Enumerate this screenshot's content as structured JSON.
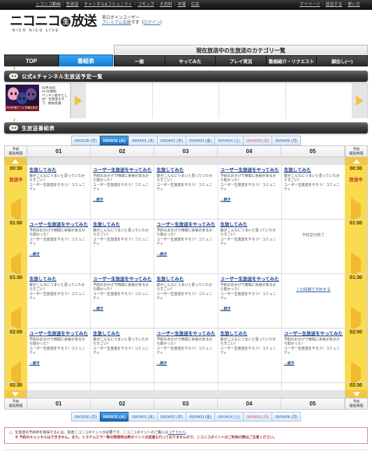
{
  "globalnav": {
    "left_links": [
      "ニコニコ動画",
      "生放送",
      "チャンネル&コミュニティ",
      "コモンズ",
      "大百科",
      "市場",
      "広告"
    ],
    "right_links": [
      "マイページ",
      "放送する",
      "使い方"
    ]
  },
  "logo": {
    "main_left": "ニコニコ",
    "ball": "生",
    "main_right": "放送",
    "sub": "NICO NICO  LIVE",
    "login_line1": "非ログインユーザー",
    "login_premium": "プレミアム会員",
    "login_suffix": "です（",
    "login_link": "ログイン",
    "login_close": "）"
  },
  "tabs": {
    "main": [
      {
        "label": "TOP",
        "active": false
      },
      {
        "label": "番組表",
        "active": true
      }
    ],
    "category_title": "現在放送中の生放送のカテゴリ一覧",
    "categories": [
      "一般",
      "やってみた",
      "プレイ実況",
      "動画紹介・リクエスト",
      "顔出し(一)"
    ]
  },
  "official_section": {
    "heading": "公式&チャンネル生放送予定一覧",
    "prev_label": "前へ",
    "next_label": "次へ",
    "items": [
      {
        "date": "03月29日",
        "time": "21:00開始",
        "title": "ペンギン娘すたじ",
        "subtitle": "お！生放送ます",
        "extra": "プ、極秘会議",
        "caption": "2009年春アニメ 特番生放送"
      }
    ]
  },
  "schedule_section": {
    "heading": "生放送番組表",
    "dates": [
      {
        "label": "09/03/30 (月)",
        "active": false,
        "kind": "weekday"
      },
      {
        "label": "09/03/31 (火)",
        "active": true,
        "kind": "weekday"
      },
      {
        "label": "09/04/01 (水)",
        "active": false,
        "kind": "weekday"
      },
      {
        "label": "09/04/02 (木)",
        "active": false,
        "kind": "weekday"
      },
      {
        "label": "09/04/03 (金)",
        "active": false,
        "kind": "weekday"
      },
      {
        "label": "09/04/04 (土)",
        "active": false,
        "kind": "sat"
      },
      {
        "label": "09/04/05 (日)",
        "active": false,
        "kind": "sun"
      },
      {
        "label": "09/04/06 (月)",
        "active": false,
        "kind": "weekday"
      }
    ],
    "side_header_line1": "予約",
    "side_header_line2": "開始時間",
    "columns": [
      "01",
      "02",
      "03",
      "04",
      "05"
    ],
    "onair_label": "放送中",
    "scroll_up_label": "上へスクロール",
    "scroll_down_label": "下へスクロール",
    "slots": [
      {
        "time": "00:30",
        "onair": true,
        "cells": [
          {
            "title": "生放してみた",
            "desc": "歌がこんなにうまいと思っていたからすごい！",
            "meta": "ユーザー生放送をやろう！コミュニティ",
            "more": ""
          },
          {
            "title": "ユーザー生放送をやってみた",
            "desc": "予約のおかげで時間に余裕があるから助かった！",
            "meta": "ユーザー生放送をやろう！コミュニティ",
            "more": "…続き"
          },
          {
            "title": "生放してみた",
            "desc": "歌がこんなにうまいと思っていたからすごい！",
            "meta": "ユーザー生放送をやろう！コミュニティ",
            "more": ""
          },
          {
            "title": "ユーザー生放送をやってみた",
            "desc": "予約のおかげで時間に余裕があるから助かった！",
            "meta": "ユーザー生放送をやろう！コミュニティ",
            "more": "…続き"
          },
          {
            "title": "生放してみた",
            "desc": "歌がこんなにうまいと思っていたからすごい！",
            "meta": "ユーザー生放送をやろう！コミュニティ",
            "more": ""
          }
        ]
      },
      {
        "time": "01:00",
        "onair": false,
        "cells": [
          {
            "title": "ユーザー生放送をやってみた",
            "desc": "予約のおかげで時間に余裕があるから助かった！",
            "meta": "ユーザー生放送をやろう！コミュニティ",
            "more": "…続き"
          },
          {
            "title": "生放してみた",
            "desc": "歌がこんなにうまいと思っていたからすごい！",
            "meta": "ユーザー生放送をやろう！コミュニティ",
            "more": ""
          },
          {
            "title": "ユーザー生放送をやってみた",
            "desc": "予約のおかげで時間に余裕があるから助かった！",
            "meta": "ユーザー生放送をやろう！コミュニティ",
            "more": "…続き"
          },
          {
            "title": "生放してみた",
            "desc": "歌がこんなにうまいと思っていたからすごい！",
            "meta": "ユーザー生放送をやろう！コミュニティ",
            "more": ""
          },
          {
            "empty_label": "予約受付終了"
          }
        ]
      },
      {
        "time": "01:30",
        "onair": false,
        "cells": [
          {
            "title": "生放してみた",
            "desc": "歌がこんなにうまいと思っていたからすごい！",
            "meta": "ユーザー生放送をやろう！コミュニティ",
            "more": ""
          },
          {
            "title": "ユーザー生放送をやってみた",
            "desc": "予約のおかげで時間に余裕があるから助かった！",
            "meta": "ユーザー生放送をやろう！コミュニティ",
            "more": "…続き"
          },
          {
            "title": "生放してみた",
            "desc": "歌がこんなにうまいと思っていたからすごい！",
            "meta": "ユーザー生放送をやろう！コミュニティ",
            "more": ""
          },
          {
            "title": "ユーザー生放送をやってみた",
            "desc": "予約のおかげで時間に余裕があるから助かった！",
            "meta": "ユーザー生放送をやろう！コミュニティ",
            "more": "…続き"
          },
          {
            "reserve_label": "この時間で予約する"
          }
        ]
      },
      {
        "time": "02:00",
        "onair": false,
        "cells": [
          {
            "title": "ユーザー生放送をやってみた",
            "desc": "予約のおかげで時間に余裕があるから助かった！",
            "meta": "ユーザー生放送をやろう！コミュニティ",
            "more": "…続き"
          },
          {
            "title": "生放してみた",
            "desc": "歌がこんなにうまいと思っていたからすごい！",
            "meta": "ユーザー生放送をやろう！コミュニティ",
            "more": ""
          },
          {
            "title": "ユーザー生放送をやってみた",
            "desc": "予約のおかげで時間に余裕があるから助かった！",
            "meta": "ユーザー生放送をやろう！コミュニティ",
            "more": "…続き"
          },
          {
            "title": "生放してみた",
            "desc": "歌がこんなにうまいと思っていたからすごい！",
            "meta": "ユーザー生放送をやろう！コミュニティ",
            "more": ""
          },
          {
            "title": "ユーザー生放送をやってみた",
            "desc": "予約のおかげで時間に余裕があるから助かった！",
            "meta": "ユーザー生放送をやろう！コミュニティ",
            "more": "…続き"
          }
        ]
      },
      {
        "time": "02:30",
        "onair": false,
        "cells": []
      }
    ]
  },
  "notice": {
    "line1_a": "生放送の予約枠を取得するには、別途ニコニコポイントが必要です。ニコニコポイントのご購入は",
    "line1_link": "コチラから",
    "line1_b": "。",
    "line2": "※ 予約のキャンセルはできません。また、システムエラー等の障害時は弊ポイントの返還も行っておりませんので、ニコニコポイントのご利用の際はご注意ください。"
  },
  "colors": {
    "accent_blue": "#1179d4",
    "time_yellow": "#fada4e",
    "onair_red": "#c0392b",
    "link_blue": "#1b3f8f"
  }
}
